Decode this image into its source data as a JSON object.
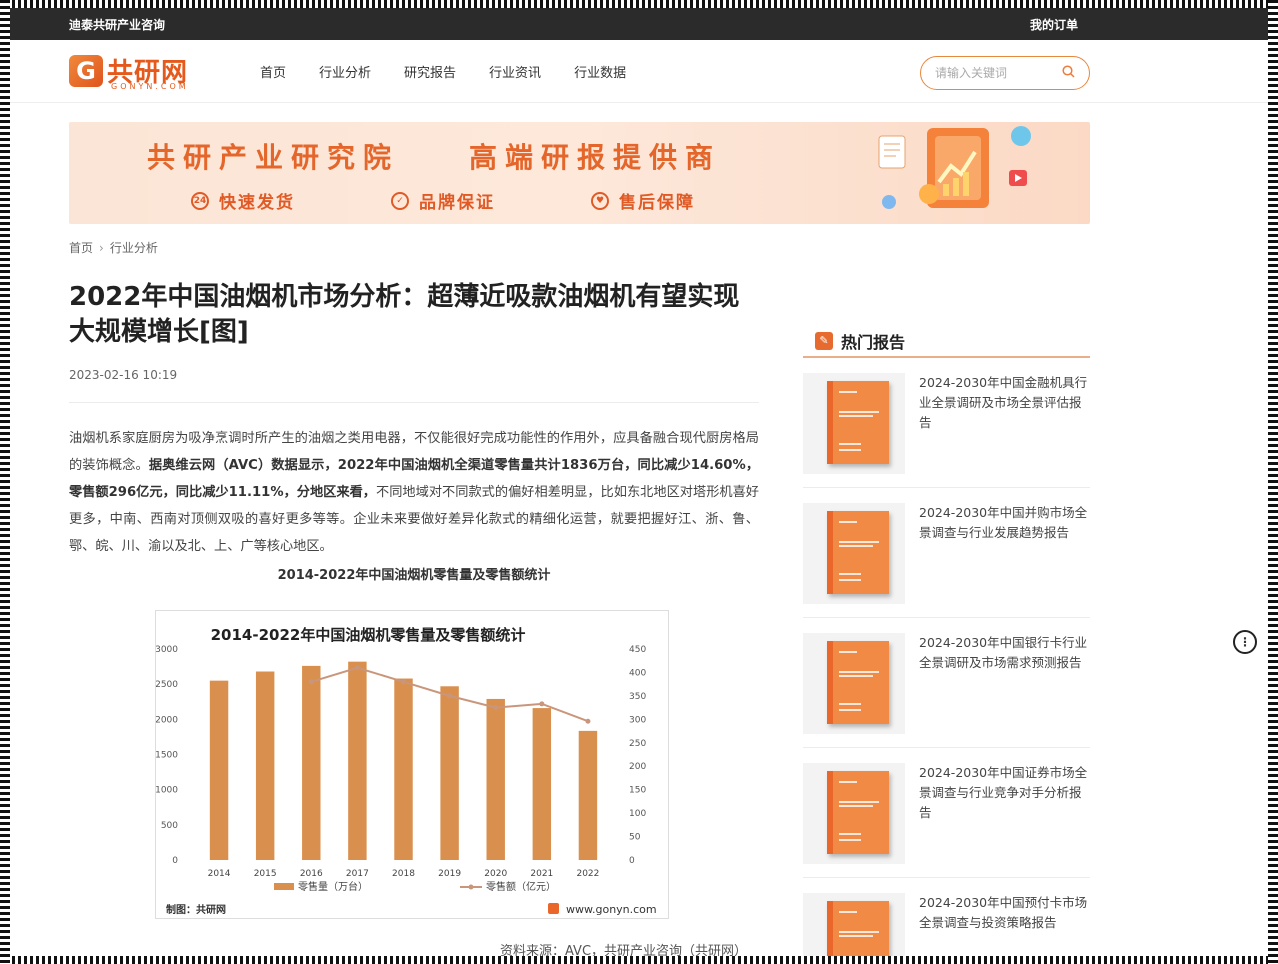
{
  "topbar": {
    "left": "迪泰共研产业咨询",
    "right": "我的订单"
  },
  "brand": {
    "name": "共研网",
    "sub": "GONYN.COM",
    "mark": "G"
  },
  "nav": [
    "首页",
    "行业分析",
    "研究报告",
    "行业资讯",
    "行业数据"
  ],
  "search": {
    "placeholder": "请输入关键词"
  },
  "banner": {
    "title_left": "共研产业研究院",
    "title_right": "高端研报提供商",
    "features": [
      "快速发货",
      "品牌保证",
      "售后保障"
    ]
  },
  "breadcrumb": [
    "首页",
    "行业分析"
  ],
  "article": {
    "title": "2022年中国油烟机市场分析：超薄近吸款油烟机有望实现大规模增长[图]",
    "date": "2023-02-16 10:19",
    "p_1": "油烟机系家庭厨房为吸净烹调时所产生的油烟之类用电器，不仅能很好完成功能性的作用外，应具备融合现代厨房格局的装饰概念。",
    "p_bold": "据奥维云网（AVC）数据显示，2022年中国油烟机全渠道零售量共计1836万台，同比减少14.60%，零售额296亿元，同比减少11.11%，分地区来看，",
    "p_2": "不同地域对不同款式的偏好相差明显，比如东北地区对塔形机喜好更多，中南、西南对顶侧双吸的喜好更多等等。企业未来要做好差异化款式的精细化运营，就要把握好江、浙、鲁、鄂、皖、川、渝以及北、上、广等核心地区。",
    "figure_caption": "2014-2022年中国油烟机零售量及零售额统计",
    "source": "资料来源：AVC，共研产业咨询（共研网）"
  },
  "chart_data": {
    "type": "bar",
    "title": "2014-2022年中国油烟机零售量及零售额统计",
    "categories": [
      "2014",
      "2015",
      "2016",
      "2017",
      "2018",
      "2019",
      "2020",
      "2021",
      "2022"
    ],
    "series": [
      {
        "name": "零售量（万台）",
        "type": "bar",
        "axis": "left",
        "values": [
          2550,
          2680,
          2760,
          2820,
          2580,
          2470,
          2290,
          2160,
          1836
        ]
      },
      {
        "name": "零售额（亿元）",
        "type": "line",
        "axis": "right",
        "values": [
          null,
          null,
          380,
          410,
          380,
          350,
          325,
          333,
          296
        ]
      }
    ],
    "left_ticks": [
      "3000",
      "2500",
      "2000",
      "1500",
      "1000",
      "500",
      "0"
    ],
    "right_ticks": [
      "450",
      "400",
      "350",
      "300",
      "250",
      "200",
      "150",
      "100",
      "50",
      "0"
    ],
    "ylim_left": [
      0,
      3000
    ],
    "ylim_right": [
      0,
      450
    ],
    "footer_left": "制图：共研网",
    "footer_right": "www.gonyn.com",
    "colors": {
      "bar": "#d9904f",
      "line": "#c9967b"
    }
  },
  "sidebar": {
    "title": "热门报告",
    "reports": [
      "2024-2030年中国金融机具行业全景调研及市场全景评估报告",
      "2024-2030年中国并购市场全景调查与行业发展趋势报告",
      "2024-2030年中国银行卡行业全景调研及市场需求预测报告",
      "2024-2030年中国证券市场全景调查与行业竞争对手分析报告",
      "2024-2030年中国预付卡市场全景调查与投资策略报告"
    ]
  }
}
